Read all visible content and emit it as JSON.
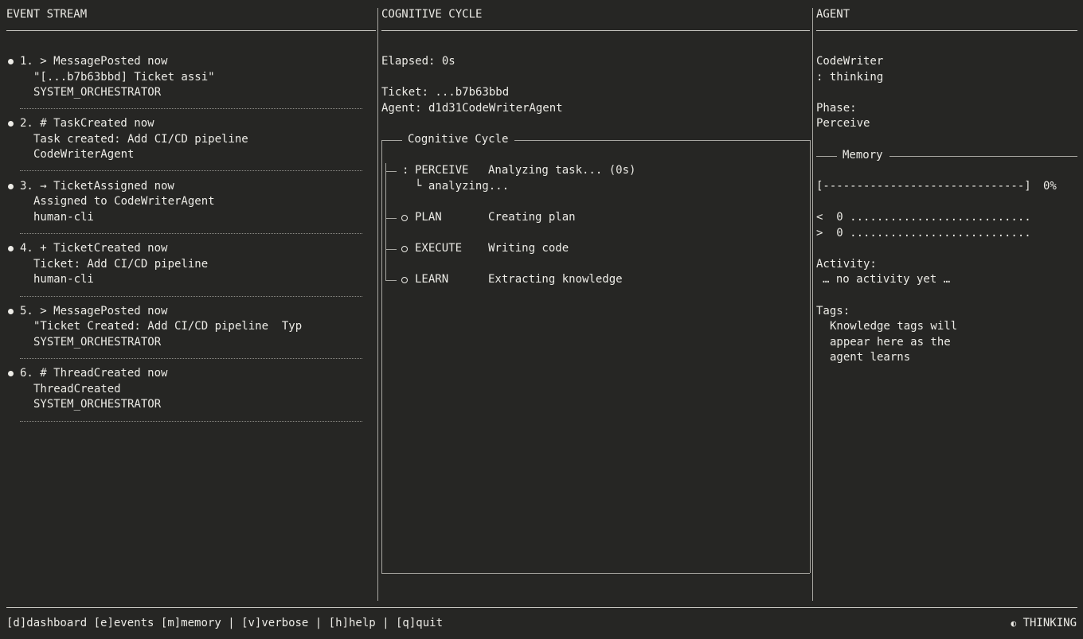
{
  "panels": {
    "events_title": "EVENT STREAM",
    "cycle_title": "COGNITIVE CYCLE",
    "agent_title": "AGENT"
  },
  "events": [
    {
      "head": "1. > MessagePosted now",
      "detail": "\"[...b7b63bbd] Ticket assi\"",
      "source": "SYSTEM_ORCHESTRATOR"
    },
    {
      "head": "2. # TaskCreated now",
      "detail": "Task created: Add CI/CD pipeline",
      "source": "CodeWriterAgent"
    },
    {
      "head": "3. → TicketAssigned now",
      "detail": "Assigned to CodeWriterAgent",
      "source": "human-cli"
    },
    {
      "head": "4. + TicketCreated now",
      "detail": "Ticket: Add CI/CD pipeline",
      "source": "human-cli"
    },
    {
      "head": "5. > MessagePosted now",
      "detail": "\"Ticket Created: Add CI/CD pipeline  Typ",
      "source": "SYSTEM_ORCHESTRATOR"
    },
    {
      "head": "6. # ThreadCreated now",
      "detail": "ThreadCreated",
      "source": "SYSTEM_ORCHESTRATOR"
    }
  ],
  "cycle": {
    "elapsed": "Elapsed: 0s",
    "ticket": "Ticket: ...b7b63bbd",
    "agent": "Agent: d1d31CodeWriterAgent",
    "section_title": "Cognitive Cycle",
    "phases": [
      {
        "marker": ":",
        "name": "PERCEIVE",
        "desc": "Analyzing task... (0s)",
        "sub": "└ analyzing...",
        "active": true
      },
      {
        "marker": "○",
        "name": "PLAN",
        "desc": "Creating plan",
        "active": false
      },
      {
        "marker": "○",
        "name": "EXECUTE",
        "desc": "Writing code",
        "active": false
      },
      {
        "marker": "○",
        "name": "LEARN",
        "desc": "Extracting knowledge",
        "active": false
      }
    ]
  },
  "agent": {
    "name": "CodeWriter",
    "state": ": thinking",
    "phase_label": "Phase:",
    "phase_value": "Perceive",
    "memory_title": "Memory",
    "memory_bar": "[------------------------------]",
    "memory_pct": "0%",
    "mem_in": "<  0 ...........................",
    "mem_out": ">  0 ...........................",
    "activity_label": "Activity:",
    "activity_value": "… no activity yet …",
    "tags_label": "Tags:",
    "tags_lines": [
      "Knowledge tags will",
      "appear here as the",
      "agent learns"
    ]
  },
  "footer": {
    "dashboard": "[d]dashboard",
    "events": "[e]events",
    "memory": "[m]memory",
    "sep": "|",
    "verbose": "[v]verbose",
    "help": "[h]help",
    "quit": "[q]quit",
    "status_icon": "◐",
    "status": "THINKING"
  }
}
